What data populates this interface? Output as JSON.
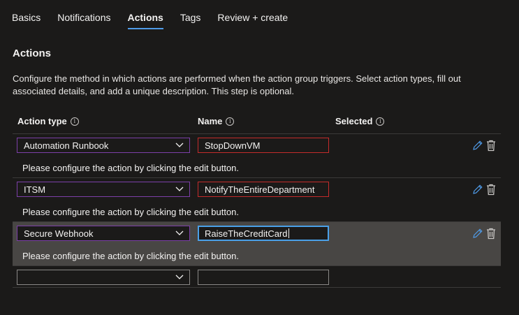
{
  "tabs": [
    {
      "label": "Basics"
    },
    {
      "label": "Notifications"
    },
    {
      "label": "Actions"
    },
    {
      "label": "Tags"
    },
    {
      "label": "Review + create"
    }
  ],
  "section_title": "Actions",
  "description": "Configure the method in which actions are performed when the action group triggers. Select action types, fill out associated details, and add a unique description. This step is optional.",
  "columns": {
    "action_type": "Action type",
    "name": "Name",
    "selected": "Selected"
  },
  "rows": [
    {
      "action_type": "Automation Runbook",
      "name": "StopDownVM",
      "message": "Please configure the action by clicking the edit button."
    },
    {
      "action_type": "ITSM",
      "name": "NotifyTheEntireDepartment",
      "message": "Please configure the action by clicking the edit button."
    },
    {
      "action_type": "Secure Webhook",
      "name": "RaiseTheCreditCard",
      "message": "Please configure the action by clicking the edit button."
    }
  ],
  "colors": {
    "accent": "#4f9be8",
    "error_border": "#c42b2b",
    "select_border": "#7c3fa8"
  }
}
